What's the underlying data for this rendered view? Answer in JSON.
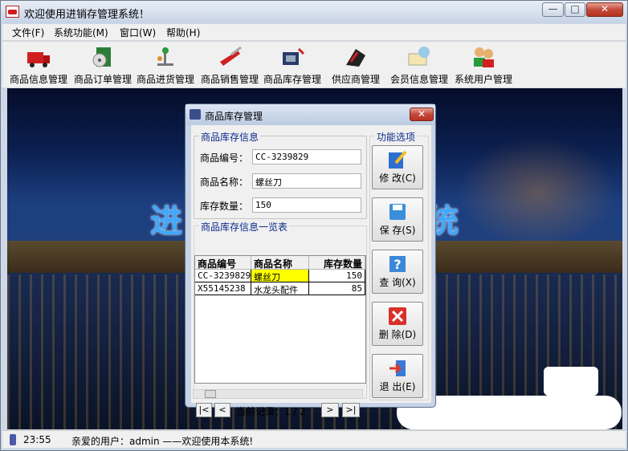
{
  "window": {
    "title": "欢迎使用进销存管理系统！",
    "min_glyph": "—",
    "max_glyph": "□",
    "close_glyph": "✕"
  },
  "menu": {
    "items": [
      "文件(F)",
      "系统功能(M)",
      "窗口(W)",
      "帮助(H)"
    ]
  },
  "toolbar": {
    "items": [
      {
        "label": "商品信息管理",
        "icon": "truck-icon"
      },
      {
        "label": "商品订单管理",
        "icon": "book-disc-icon"
      },
      {
        "label": "商品进货管理",
        "icon": "conveyor-icon"
      },
      {
        "label": "商品销售管理",
        "icon": "swiss-knife-icon"
      },
      {
        "label": "商品库存管理",
        "icon": "inventory-icon"
      },
      {
        "label": "供应商管理",
        "icon": "piano-icon"
      },
      {
        "label": "会员信息管理",
        "icon": "member-card-icon"
      },
      {
        "label": "系统用户管理",
        "icon": "users-icon"
      }
    ]
  },
  "background": {
    "title_left": "进",
    "title_right": "统"
  },
  "dialog": {
    "title": "商品库存管理",
    "close_glyph": "✕",
    "info_group": "商品库存信息",
    "code_label": "商品编号：",
    "code_value": "CC-3239829",
    "name_label": "商品名称：",
    "name_value": "螺丝刀",
    "qty_label": "库存数量：",
    "qty_value": "150",
    "list_group": "商品库存信息一览表",
    "columns": [
      "商品编号",
      "商品名称",
      "库存数量"
    ],
    "rows": [
      [
        "CC-3239829",
        "螺丝刀",
        "150"
      ],
      [
        "X55145238",
        "水龙头配件",
        "85"
      ]
    ],
    "nav": {
      "first": "|<",
      "prev": "<",
      "record_text": "当前记录：1 / 2",
      "next": ">",
      "last": ">|"
    },
    "func_group": "功能选项",
    "buttons": [
      {
        "label": "修 改(C)",
        "icon": "edit-icon",
        "color": "#2d6fd0"
      },
      {
        "label": "保 存(S)",
        "icon": "save-icon",
        "color": "#3a8fd8"
      },
      {
        "label": "查 询(X)",
        "icon": "help-icon",
        "color": "#3a88d8"
      },
      {
        "label": "删 除(D)",
        "icon": "delete-icon",
        "color": "#d8302a"
      },
      {
        "label": "退 出(E)",
        "icon": "exit-icon",
        "color": "#d83a2a"
      }
    ]
  },
  "status": {
    "time": "23:55",
    "message": "亲爱的用户：admin ——欢迎使用本系统!"
  },
  "colors": {
    "accent": "#0b2a8a",
    "highlight": "#ffff00",
    "title_blue": "#3fa8ff"
  }
}
